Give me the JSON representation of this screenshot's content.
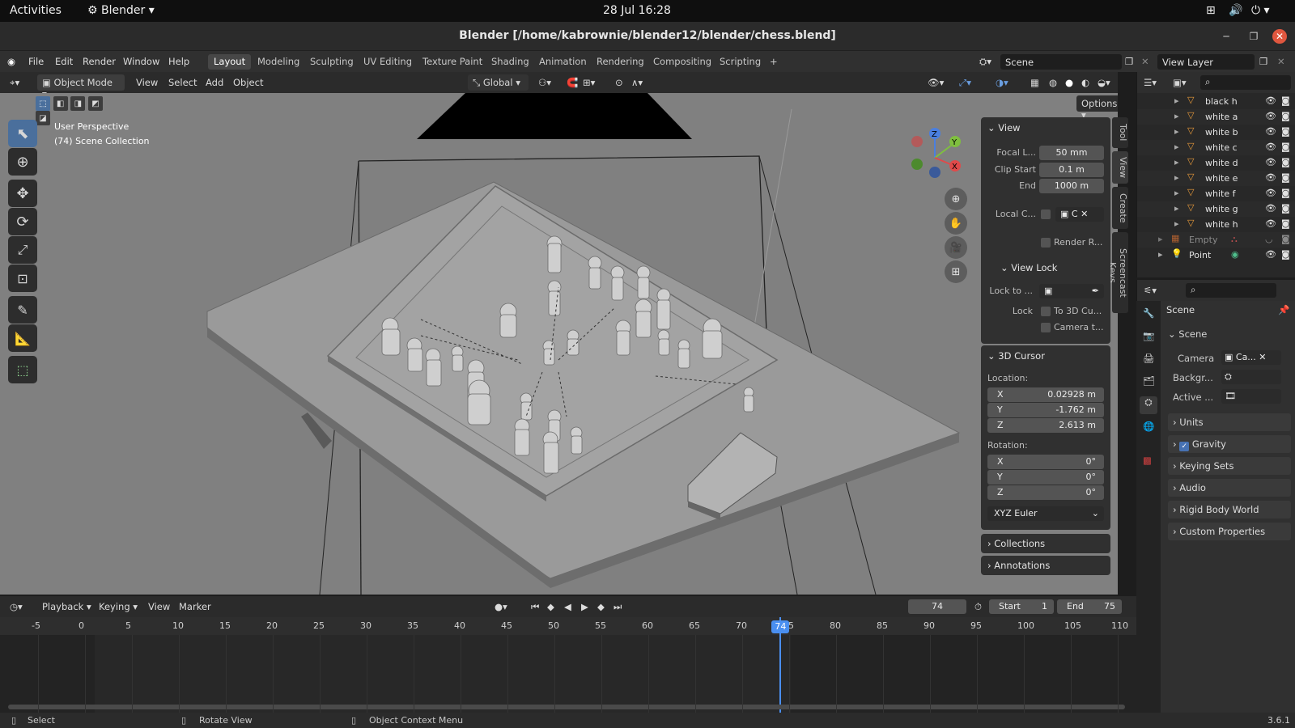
{
  "gnome": {
    "activities": "Activities",
    "app": "Blender",
    "clock": "28 Jul  16:28"
  },
  "window": {
    "title": "Blender [/home/kabrownie/blender12/blender/chess.blend]"
  },
  "menu": {
    "items": [
      "File",
      "Edit",
      "Render",
      "Window",
      "Help"
    ]
  },
  "workspaces": [
    "Layout",
    "Modeling",
    "Sculpting",
    "UV Editing",
    "Texture Paint",
    "Shading",
    "Animation",
    "Rendering",
    "Compositing",
    "Scripting"
  ],
  "active_workspace": "Layout",
  "scene_field": "Scene",
  "viewlayer_field": "View Layer",
  "viewport_header": {
    "mode": "Object Mode",
    "menus": [
      "View",
      "Select",
      "Add",
      "Object"
    ],
    "transform": "Global",
    "options": "Options"
  },
  "viewport": {
    "perspective": "User Perspective",
    "collection": "(74) Scene Collection"
  },
  "npanel": {
    "view_title": "View",
    "focal_label": "Focal L...",
    "focal": "50 mm",
    "clip_start_label": "Clip Start",
    "clip_start": "0.1 m",
    "end_label": "End",
    "end": "1000 m",
    "local_label": "Local C...",
    "local_val": "C",
    "render_region": "Render R...",
    "view_lock_title": "View Lock",
    "lock_to_label": "Lock to ...",
    "lock_label": "Lock",
    "to_cursor": "To 3D Cu...",
    "camera_to": "Camera t...",
    "cursor_title": "3D Cursor",
    "location_label": "Location:",
    "loc_x": "0.02928 m",
    "loc_y": "-1.762 m",
    "loc_z": "2.613 m",
    "rotation_label": "Rotation:",
    "rot_x": "0°",
    "rot_y": "0°",
    "rot_z": "0°",
    "x": "X",
    "y": "Y",
    "z": "Z",
    "rotation_mode": "XYZ Euler",
    "collections": "Collections",
    "annotations": "Annotations"
  },
  "vtabs": [
    "Tool",
    "View",
    "Create",
    "Screencast Keys"
  ],
  "outliner": {
    "items": [
      "black h",
      "white a",
      "white b",
      "white c",
      "white d",
      "white e",
      "white f",
      "white g",
      "white h",
      "Empty",
      "Point"
    ]
  },
  "properties": {
    "header": "Scene",
    "section": "Scene",
    "camera_label": "Camera",
    "camera_val": "Ca...",
    "background_label": "Backgr...",
    "active_label": "Active ...",
    "subsections": [
      "Units",
      "Gravity",
      "Keying Sets",
      "Audio",
      "Rigid Body World",
      "Custom Properties"
    ]
  },
  "timeline": {
    "menus": [
      "Playback",
      "Keying",
      "View",
      "Marker"
    ],
    "current_frame": "74",
    "start_label": "Start",
    "start": "1",
    "end_label": "End",
    "end": "75",
    "ticks": [
      "-5",
      "0",
      "5",
      "10",
      "15",
      "20",
      "25",
      "30",
      "35",
      "40",
      "45",
      "50",
      "55",
      "60",
      "65",
      "70",
      "75",
      "80",
      "85",
      "90",
      "95",
      "100",
      "105",
      "110"
    ]
  },
  "status": {
    "select": "Select",
    "rotate": "Rotate View",
    "context": "Object Context Menu",
    "version": "3.6.1"
  },
  "colors": {
    "accent": "#4772b3",
    "playhead": "#4a8ff0",
    "close": "#e0573f"
  }
}
